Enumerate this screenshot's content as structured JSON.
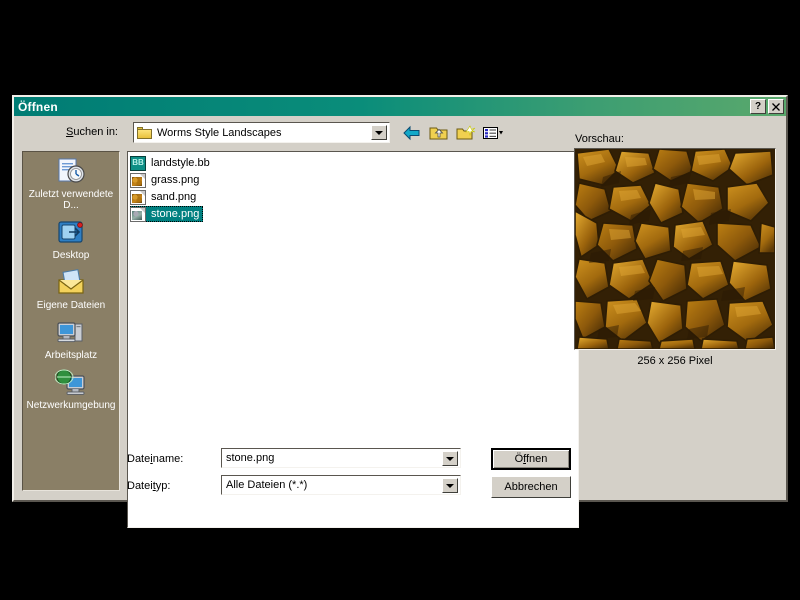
{
  "dialog": {
    "title": "Öffnen",
    "help_button": "?",
    "close_button": "✕"
  },
  "lookin": {
    "label": "Suchen in:",
    "value": "Worms Style Landscapes",
    "icon": "folder-icon"
  },
  "toolbar": {
    "buttons": [
      {
        "name": "back-button",
        "icon": "back-arrow-icon",
        "label": "Zurück"
      },
      {
        "name": "up-one-level-button",
        "icon": "up-folder-icon",
        "label": "Eine Ebene höher"
      },
      {
        "name": "new-folder-button",
        "icon": "new-folder-icon",
        "label": "Neuen Ordner erstellen"
      },
      {
        "name": "views-button",
        "icon": "views-list-icon",
        "label": "Ansicht"
      }
    ]
  },
  "places": {
    "items": [
      {
        "label": "Zuletzt verwendete D...",
        "icon": "recent-documents-icon"
      },
      {
        "label": "Desktop",
        "icon": "desktop-icon"
      },
      {
        "label": "Eigene Dateien",
        "icon": "my-documents-icon"
      },
      {
        "label": "Arbeitsplatz",
        "icon": "my-computer-icon"
      },
      {
        "label": "Netzwerkumgebung",
        "icon": "network-neighborhood-icon"
      }
    ]
  },
  "filelist": {
    "files": [
      {
        "name": "landstyle.bb",
        "icon": "blitzbasic-file-icon",
        "selected": false
      },
      {
        "name": "grass.png",
        "icon": "png-image-file-icon",
        "selected": false
      },
      {
        "name": "sand.png",
        "icon": "png-image-file-icon",
        "selected": false
      },
      {
        "name": "stone.png",
        "icon": "png-image-file-icon",
        "selected": true
      }
    ]
  },
  "preview": {
    "label": "Vorschau:",
    "caption": "256 x 256 Pixel",
    "image_alt": "stone-texture-preview"
  },
  "fields": {
    "filename_label": "Dateiname:",
    "filename_value": "stone.png",
    "filetype_label": "Dateityp:",
    "filetype_value": "Alle Dateien (*.*)"
  },
  "buttons": {
    "open": "Öffnen",
    "cancel": "Abbrechen"
  },
  "colors": {
    "titlebar_start": "#007c74",
    "titlebar_end": "#5aa86c",
    "dialog_face": "#d4d0c8",
    "places_bar": "#8a7f66",
    "selection": "#008080",
    "desktop": "#000000"
  }
}
